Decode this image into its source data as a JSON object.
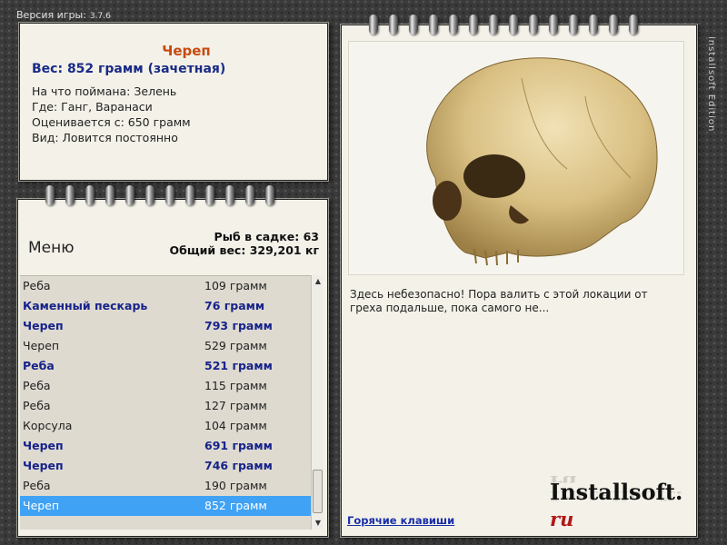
{
  "header": {
    "version_label": "Версия игры:",
    "version_number": "3.7.6"
  },
  "sidebar_text": "installsoft Edition",
  "info": {
    "title": "Череп",
    "weight": "Вес: 852 грамм (зачетная)",
    "caught_on": "На что поймана: Зелень",
    "location": "Где: Ганг, Варанаси",
    "valued_from": "Оценивается с: 650 грамм",
    "kind": "Вид: Ловится постоянно"
  },
  "menu": {
    "label": "Меню",
    "fish_count": "Рыб в садке: 63",
    "total_weight": "Общий вес: 329,201 кг"
  },
  "catch_list": [
    {
      "name": "Реба",
      "weight": "109 грамм",
      "style": "normal"
    },
    {
      "name": "Каменный пескарь",
      "weight": "76 грамм",
      "style": "highlight"
    },
    {
      "name": "Череп",
      "weight": "793 грамм",
      "style": "highlight"
    },
    {
      "name": "Череп",
      "weight": "529 грамм",
      "style": "normal"
    },
    {
      "name": "Реба",
      "weight": "521 грамм",
      "style": "highlight"
    },
    {
      "name": "Реба",
      "weight": "115 грамм",
      "style": "normal"
    },
    {
      "name": "Реба",
      "weight": "127 грамм",
      "style": "normal"
    },
    {
      "name": "Корсула",
      "weight": "104 грамм",
      "style": "normal"
    },
    {
      "name": "Череп",
      "weight": "691 грамм",
      "style": "highlight"
    },
    {
      "name": "Череп",
      "weight": "746 грамм",
      "style": "highlight"
    },
    {
      "name": "Реба",
      "weight": "190 грамм",
      "style": "normal"
    },
    {
      "name": "Череп",
      "weight": "852 грамм",
      "style": "selected"
    }
  ],
  "page": {
    "message": "Здесь небезопасно! Пора валить с этой локации от греха подальше, пока самого не...",
    "hotkeys": "Горячие клавиши",
    "brand_name": "Installsoft.",
    "brand_tld": "ru"
  },
  "colors": {
    "title": "#c84a10",
    "highlight": "#17238a",
    "selection": "#3fa2f5",
    "link": "#1a2fa8"
  },
  "icons": {
    "photo": "skull-photo",
    "scroll_up": "arrow-up-icon",
    "scroll_down": "arrow-down-icon"
  }
}
